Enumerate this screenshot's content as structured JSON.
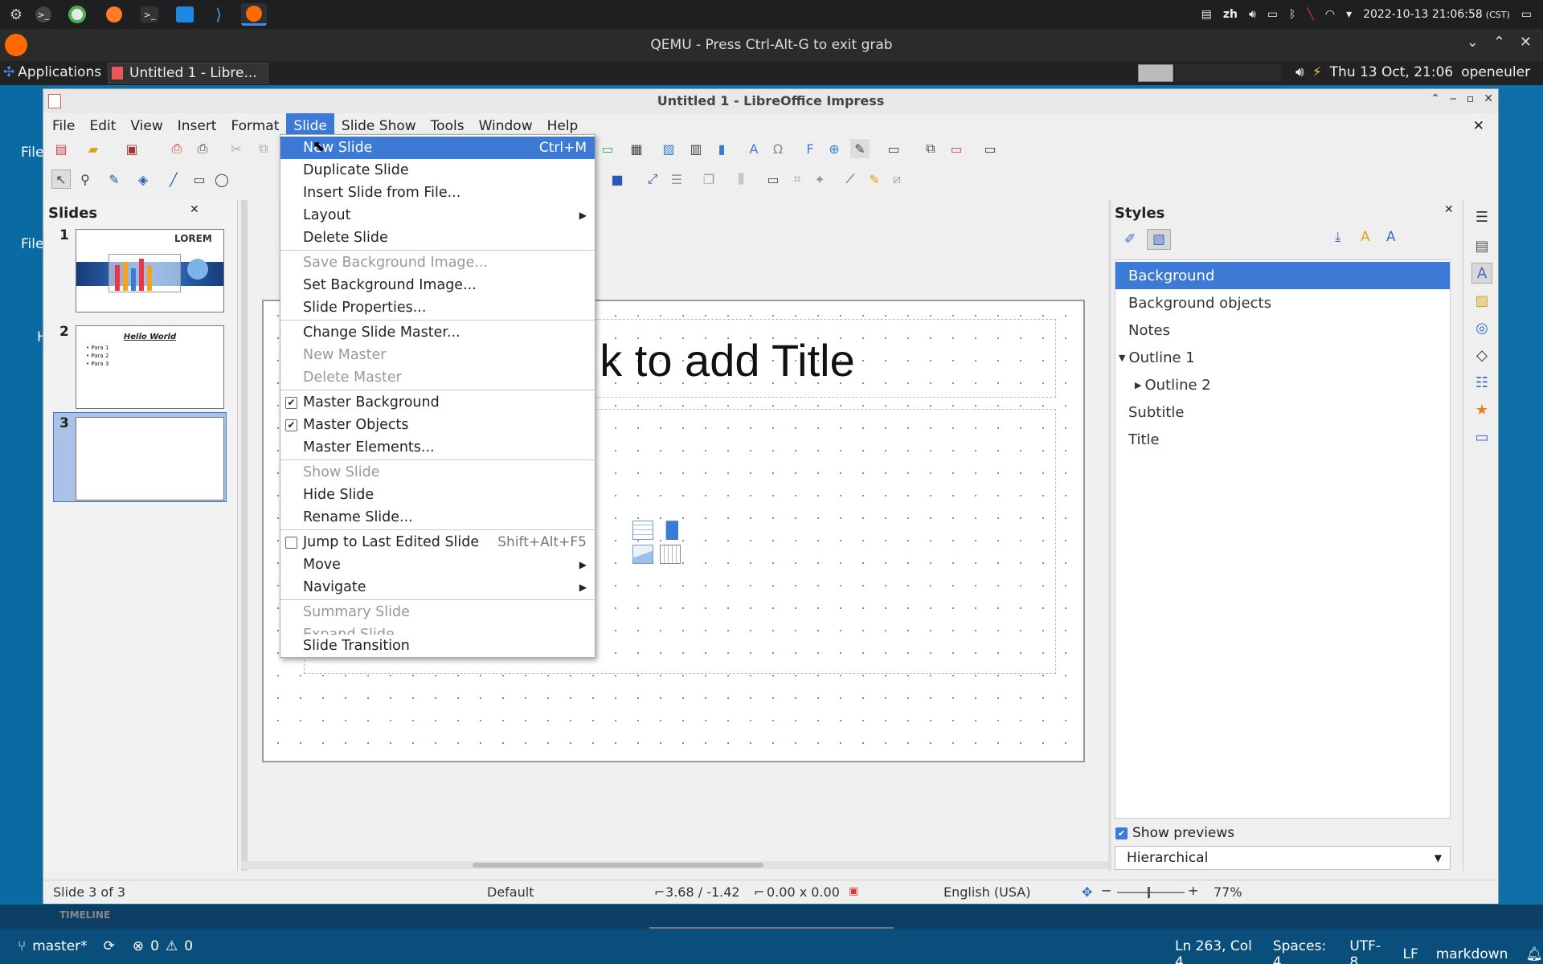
{
  "topbar": {
    "lang": "zh",
    "datetime": "2022-10-13 21:06:58",
    "tz": "(CST)",
    "apps": [
      "system-icon",
      "terminal-icon",
      "chrome-icon",
      "firefox-icon",
      "terminal-icon",
      "remote-viewer-icon",
      "vscode-icon",
      "qemu-icon"
    ]
  },
  "qemu": {
    "title": "QEMU - Press Ctrl-Alt-G to exit grab"
  },
  "xfce": {
    "applications": "Applications",
    "task": "Untitled 1 - Libre...",
    "clock": "Thu 13 Oct, 21:06",
    "user": "openeuler"
  },
  "desktop": {
    "label1": "File",
    "label2": "File",
    "label3": "H"
  },
  "window": {
    "title": "Untitled 1 - LibreOffice Impress"
  },
  "menubar": [
    "File",
    "Edit",
    "View",
    "Insert",
    "Format",
    "Slide",
    "Slide Show",
    "Tools",
    "Window",
    "Help"
  ],
  "slides_pane": {
    "title": "Slides",
    "nums": [
      "1",
      "2",
      "3"
    ],
    "slide1_text": "LOREM",
    "slide2_title": "Hello World",
    "slide2_bullets": [
      "Para 1",
      "Para 2",
      "Para 3"
    ]
  },
  "slide": {
    "title_placeholder": "k to add Title"
  },
  "slide_menu": {
    "items": [
      {
        "label": "New Slide",
        "shortcut": "Ctrl+M"
      },
      {
        "label": "Duplicate Slide"
      },
      {
        "label": "Insert Slide from File..."
      },
      {
        "label": "Layout"
      },
      {
        "label": "Delete Slide"
      },
      {
        "label": "Save Background Image..."
      },
      {
        "label": "Set Background Image..."
      },
      {
        "label": "Slide Properties..."
      },
      {
        "label": "Change Slide Master..."
      },
      {
        "label": "New Master"
      },
      {
        "label": "Delete Master"
      },
      {
        "label": "Master Background"
      },
      {
        "label": "Master Objects"
      },
      {
        "label": "Master Elements..."
      },
      {
        "label": "Show Slide"
      },
      {
        "label": "Hide Slide"
      },
      {
        "label": "Rename Slide..."
      },
      {
        "label": "Jump to Last Edited Slide",
        "shortcut": "Shift+Alt+F5"
      },
      {
        "label": "Move"
      },
      {
        "label": "Navigate"
      },
      {
        "label": "Summary Slide"
      },
      {
        "label": "Expand Slide"
      },
      {
        "label": "Slide Transition"
      }
    ]
  },
  "styles": {
    "title": "Styles",
    "items": [
      "Background",
      "Background objects",
      "Notes",
      "Outline 1",
      "Outline 2",
      "Subtitle",
      "Title"
    ],
    "show_previews": "Show previews",
    "filter": "Hierarchical"
  },
  "statusbar": {
    "slide": "Slide 3 of 3",
    "master": "Default",
    "position": "3.68 / -1.42",
    "size": "0.00 x 0.00",
    "language": "English (USA)",
    "zoom": "77%"
  },
  "vscode": {
    "branch": "master*",
    "problems": "0",
    "warnings": "0",
    "position": "Ln 263, Col 4",
    "spaces": "Spaces: 4",
    "encoding": "UTF-8",
    "eol": "LF",
    "lang": "markdown",
    "timeline": "TIMELINE"
  }
}
